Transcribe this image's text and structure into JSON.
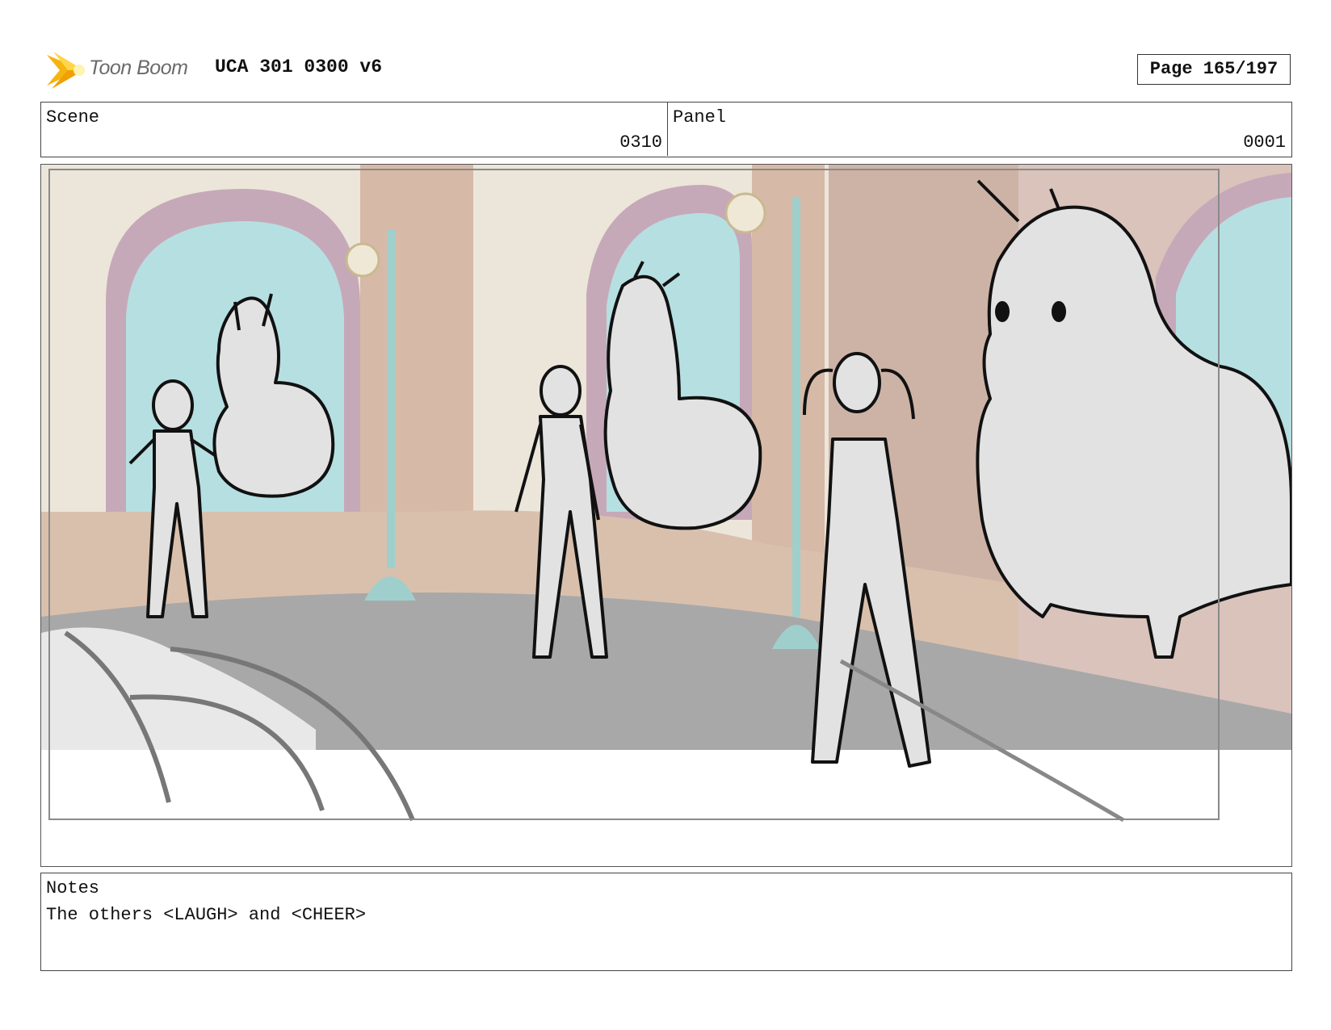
{
  "header": {
    "logo_text": "Toon Boom",
    "title": "UCA 301 0300 v6",
    "page": "Page 165/197"
  },
  "scene": {
    "label": "Scene",
    "value": "0310"
  },
  "panel": {
    "label": "Panel",
    "value": "0001"
  },
  "notes": {
    "label": "Notes",
    "text": "The others <LAUGH> and <CHEER>"
  },
  "colors": {
    "wall": "#ece6da",
    "pillar": "#d6b9a6",
    "window": "#b6dfe2",
    "arch_trim": "#c6a9b8",
    "floor": "#a8a8a8",
    "lamp_post": "#9fcfcc",
    "sketch_fill": "#e2e2e2",
    "logo_flare": "#f5b40f"
  }
}
